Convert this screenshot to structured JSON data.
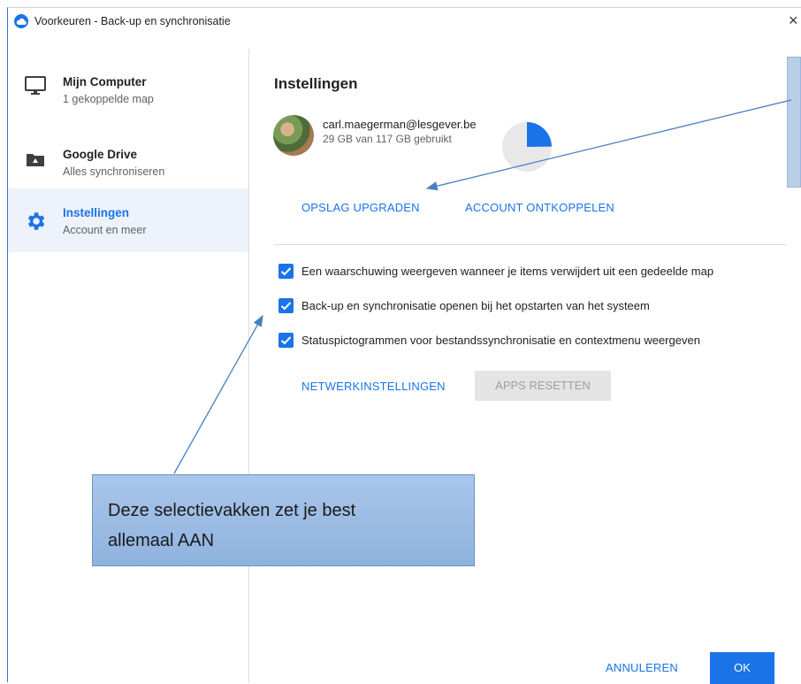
{
  "window": {
    "title": "Voorkeuren - Back-up en synchronisatie",
    "close_glyph": "×",
    "app_icon": "google-drive-cloud-icon"
  },
  "sidebar": {
    "items": [
      {
        "title": "Mijn Computer",
        "subtitle": "1 gekoppelde map",
        "icon": "monitor-icon",
        "active": false
      },
      {
        "title": "Google Drive",
        "subtitle": "Alles synchroniseren",
        "icon": "drive-folder-icon",
        "active": false
      },
      {
        "title": "Instellingen",
        "subtitle": "Account en meer",
        "icon": "gear-icon",
        "active": true
      }
    ]
  },
  "main": {
    "heading": "Instellingen",
    "account": {
      "email": "carl.maegerman@lesgever.be",
      "usage": "29 GB van 117 GB gebruikt",
      "used_fraction": 0.248
    },
    "account_buttons": {
      "upgrade": "OPSLAG UPGRADEN",
      "disconnect": "ACCOUNT ONTKOPPELEN"
    },
    "checkboxes": [
      {
        "label": "Een waarschuwing weergeven wanneer je items verwijdert uit een gedeelde map",
        "checked": true
      },
      {
        "label": "Back-up en synchronisatie openen bij het opstarten van het systeem",
        "checked": true
      },
      {
        "label": "Statuspictogrammen voor bestandssynchronisatie en contextmenu weergeven",
        "checked": true
      }
    ],
    "settings_buttons": {
      "network": "NETWERKINSTELLINGEN",
      "reset": "APPS RESETTEN"
    },
    "footer": {
      "cancel": "ANNULEREN",
      "ok": "OK"
    }
  },
  "annotation": {
    "callout_line1": "Deze selectievakken zet je best",
    "callout_line2": "allemaal AAN"
  },
  "colors": {
    "accent": "#1a73e8",
    "pie_background": "#e8e8e8",
    "sidebar_active": "#eef2fb",
    "callout_fill": "#9dbce4"
  }
}
